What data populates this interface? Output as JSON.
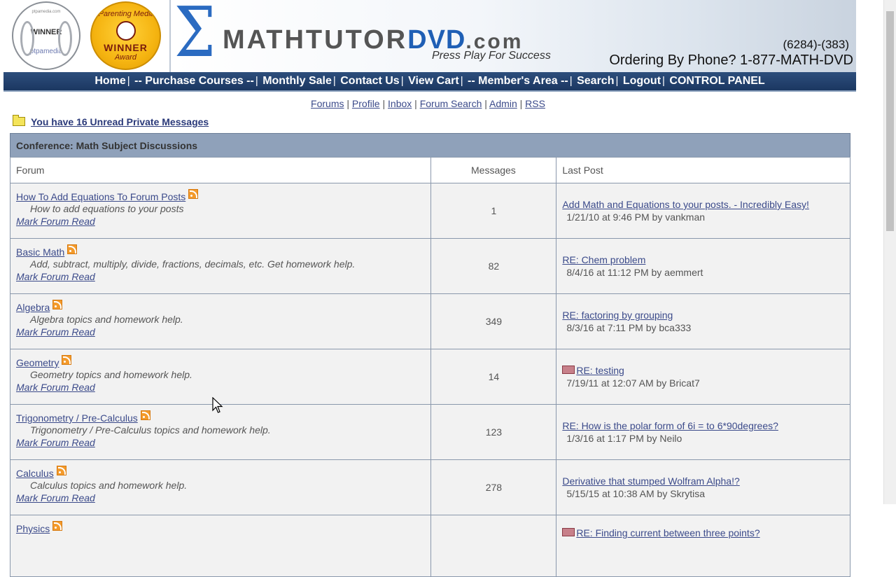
{
  "banner": {
    "award1_small": "ptpamedia.com",
    "award1_text": "WINNER",
    "award1_brand": "ptpamedia",
    "award2_top": "iParenting Media",
    "award2_winner": "WINNER",
    "award2_award": "Award",
    "logo_main": "MATHTUTOR",
    "logo_dvd": "DVD",
    "logo_tld": ".com",
    "tagline": "Press Play For Success",
    "phone_small": "(6284)-(383)",
    "phone_label": "Ordering By Phone?  1-877-MATH-DVD"
  },
  "nav": {
    "items": [
      "Home",
      "-- Purchase Courses --",
      "Monthly Sale",
      "Contact Us",
      "View Cart",
      "-- Member's Area --",
      "Search",
      "Logout",
      "CONTROL PANEL"
    ]
  },
  "subnav": {
    "items": [
      "Forums",
      "Profile",
      "Inbox",
      "Forum Search",
      "Admin",
      "RSS"
    ]
  },
  "private_messages": "You have 16 Unread Private Messages",
  "table": {
    "conference": "Conference: Math Subject Discussions",
    "col_forum": "Forum",
    "col_messages": "Messages",
    "col_lastpost": "Last Post",
    "mark_read_label": "Mark Forum Read",
    "rows": [
      {
        "name": "How To Add Equations To Forum Posts",
        "desc": "How to add equations to your posts",
        "messages": "1",
        "last_title": "Add Math and Equations to your posts. - Incredibly Easy!",
        "last_meta": "1/21/10 at 9:46 PM   by vankman"
      },
      {
        "name": "Basic Math",
        "desc": "Add, subtract, multiply, divide, fractions, decimals, etc. Get homework help.",
        "messages": "82",
        "last_title": "RE: Chem problem",
        "last_meta": "8/4/16 at 11:12 PM   by aemmert"
      },
      {
        "name": "Algebra",
        "desc": "Algebra topics and homework help.",
        "messages": "349",
        "last_title": "RE: factoring by grouping",
        "last_meta": "8/3/16 at 7:11 PM   by bca333"
      },
      {
        "name": "Geometry",
        "desc": "Geometry topics and homework help.",
        "messages": "14",
        "last_title": "RE: testing",
        "last_meta": "7/19/11 at 12:07 AM   by Bricat7"
      },
      {
        "name": "Trigonometry / Pre-Calculus",
        "desc": "Trigonometry / Pre-Calculus topics and homework help.",
        "messages": "123",
        "last_title": "RE: How is the polar form of 6i = to 6*90degrees?",
        "last_meta": "1/3/16 at 1:17 PM   by Neilo"
      },
      {
        "name": "Calculus",
        "desc": "Calculus topics and homework help.",
        "messages": "278",
        "last_title": "Derivative that stumped Wolfram Alpha!?",
        "last_meta": "5/15/15 at 10:38 AM   by Skrytisa"
      },
      {
        "name": "Physics",
        "desc": "",
        "messages": "",
        "last_title": "RE: Finding current between three points?",
        "last_meta": ""
      }
    ]
  }
}
